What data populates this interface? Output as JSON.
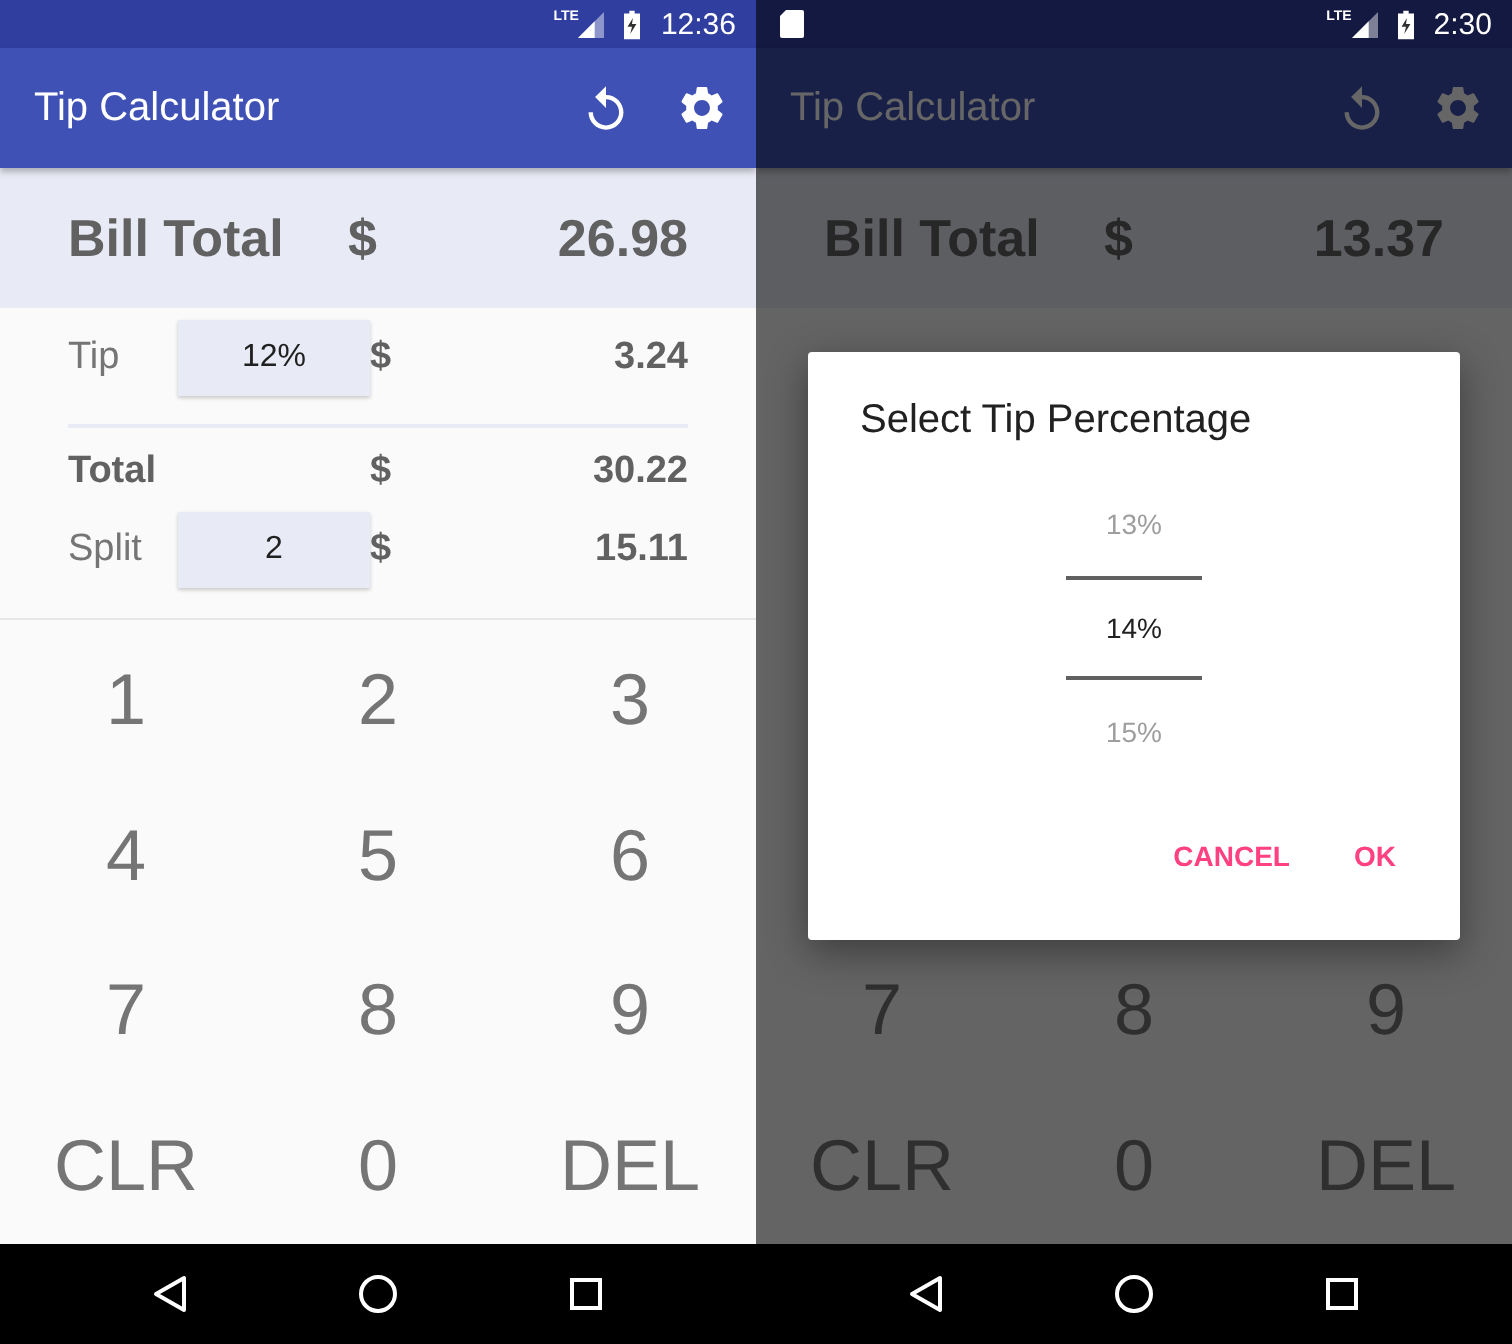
{
  "phones": [
    {
      "status": {
        "network": "LTE",
        "time": "12:36"
      },
      "app_bar": {
        "title": "Tip Calculator"
      },
      "bill": {
        "label": "Bill Total",
        "currency": "$",
        "amount": "26.98"
      },
      "summary": [
        {
          "kind": "field",
          "label": "Tip",
          "field": "12%",
          "currency": "$",
          "amount": "3.24"
        },
        {
          "kind": "divider"
        },
        {
          "kind": "total",
          "label": "Total",
          "currency": "$",
          "amount": "30.22"
        },
        {
          "kind": "field",
          "label": "Split",
          "field": "2",
          "currency": "$",
          "amount": "15.11"
        }
      ],
      "keypad": [
        [
          "1",
          "2",
          "3"
        ],
        [
          "4",
          "5",
          "6"
        ],
        [
          "7",
          "8",
          "9"
        ],
        [
          "CLR",
          "0",
          "DEL"
        ]
      ]
    },
    {
      "status": {
        "sd_card": true,
        "network": "LTE",
        "time": "2:30"
      },
      "app_bar": {
        "title": "Tip Calculator"
      },
      "bill": {
        "label": "Bill Total",
        "currency": "$",
        "amount": "13.37"
      },
      "keypad": [
        [
          "7",
          "8",
          "9"
        ],
        [
          "CLR",
          "0",
          "DEL"
        ]
      ],
      "dialog": {
        "title": "Select Tip Percentage",
        "options": [
          {
            "label": "13%",
            "selected": false
          },
          {
            "label": "14%",
            "selected": true
          },
          {
            "label": "15%",
            "selected": false
          }
        ],
        "buttons": [
          "CANCEL",
          "OK"
        ]
      }
    }
  ]
}
